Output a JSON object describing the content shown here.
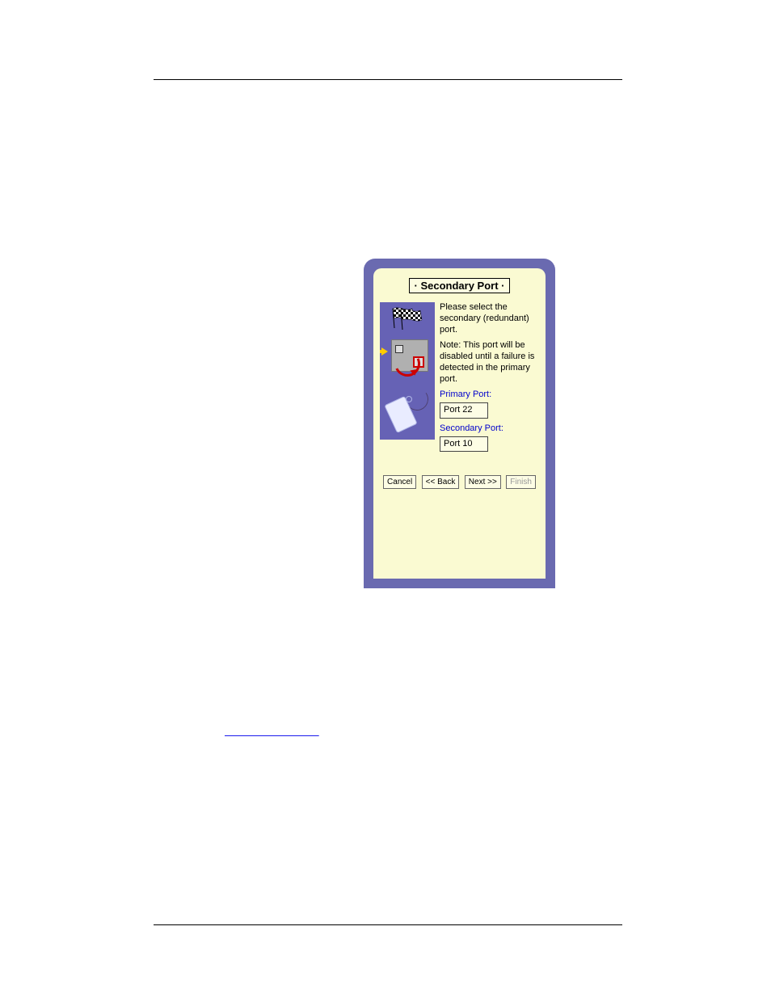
{
  "dialog": {
    "title": "· Secondary Port ·",
    "description": "Please select the secondary (redundant) port.",
    "note": "Note: This port will be disabled until a failure is detected in the primary port.",
    "primary_label": "Primary Port:",
    "primary_value": "Port 22",
    "secondary_label": "Secondary Port:",
    "secondary_value": "Port 10",
    "buttons": {
      "cancel": "Cancel",
      "back": "<< Back",
      "next": "Next >>",
      "finish": "Finish"
    }
  },
  "icons": {
    "flag": "checkered-flag-icon",
    "arrow": "yellow-right-arrow-icon",
    "device": "switch-device-icon",
    "curve": "red-redundancy-arrow-icon",
    "tag": "label-tag-icon"
  }
}
